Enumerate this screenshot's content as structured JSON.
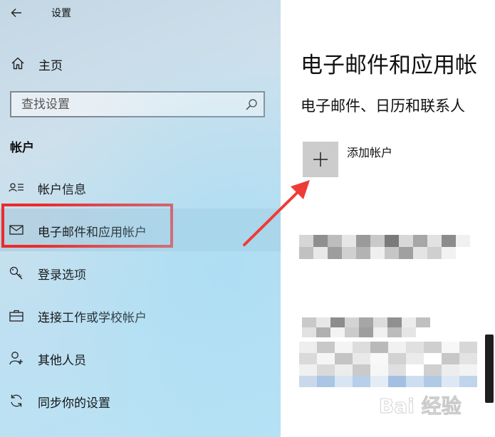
{
  "window": {
    "title": "设置"
  },
  "sidebar": {
    "home_label": "主页",
    "search_placeholder": "查找设置",
    "section_heading": "帐户",
    "items": [
      {
        "label": "帐户信息",
        "icon": "person-list-icon"
      },
      {
        "label": "电子邮件和应用帐户",
        "icon": "mail-icon"
      },
      {
        "label": "登录选项",
        "icon": "key-icon"
      },
      {
        "label": "连接工作或学校帐户",
        "icon": "briefcase-icon"
      },
      {
        "label": "其他人员",
        "icon": "person-icon"
      },
      {
        "label": "同步你的设置",
        "icon": "sync-icon"
      }
    ]
  },
  "main": {
    "page_title": "电子邮件和应用帐",
    "sub_heading": "电子邮件、日历和联系人",
    "add_account_label": "添加帐户"
  },
  "watermark": {
    "text": "Bai 经验"
  },
  "colors": {
    "highlight_border": "#ec2a2a",
    "arrow": "#ef3b35",
    "tile_bg": "#cccccc",
    "link_blue": "#1a66b8"
  }
}
